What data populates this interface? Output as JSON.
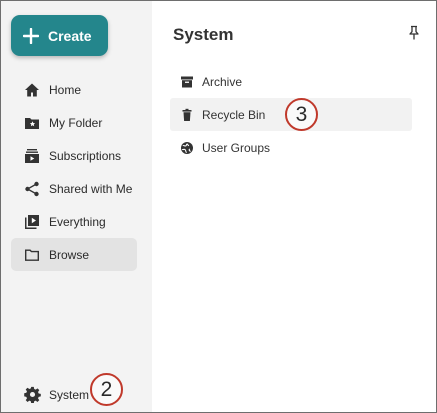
{
  "create_button": {
    "label": "Create",
    "icon": "plus-icon"
  },
  "nav": {
    "items": [
      {
        "label": "Home",
        "icon": "home-icon"
      },
      {
        "label": "My Folder",
        "icon": "starred-folder-icon"
      },
      {
        "label": "Subscriptions",
        "icon": "subscriptions-icon"
      },
      {
        "label": "Shared with Me",
        "icon": "share-icon"
      },
      {
        "label": "Everything",
        "icon": "video-library-icon"
      },
      {
        "label": "Browse",
        "icon": "folder-icon",
        "active": true
      }
    ],
    "system": {
      "label": "System",
      "icon": "gear-icon"
    }
  },
  "panel": {
    "title": "System",
    "items": [
      {
        "label": "Archive",
        "icon": "archive-icon"
      },
      {
        "label": "Recycle Bin",
        "icon": "trash-icon"
      },
      {
        "label": "User Groups",
        "icon": "globe-icon"
      }
    ]
  },
  "callouts": [
    "2",
    "3"
  ],
  "colors": {
    "accent": "#24868c",
    "callout_ring": "#c0392b",
    "sidebar_bg": "#f3f3f3"
  }
}
